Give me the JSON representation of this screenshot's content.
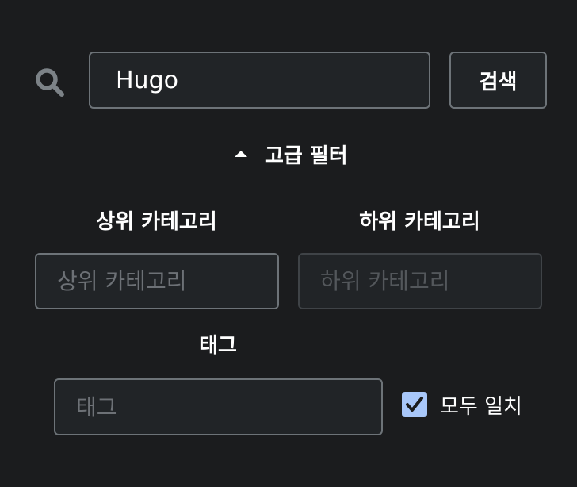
{
  "search": {
    "value": "Hugo",
    "button_label": "검색"
  },
  "advanced_filter": {
    "label": "고급 필터",
    "expanded": true
  },
  "fields": {
    "upper_category": {
      "label": "상위 카테고리",
      "placeholder": "상위 카테고리",
      "value": ""
    },
    "lower_category": {
      "label": "하위 카테고리",
      "placeholder": "하위 카테고리",
      "value": "",
      "disabled": true
    },
    "tag": {
      "label": "태그",
      "placeholder": "태그",
      "value": ""
    }
  },
  "match_all": {
    "label": "모두 일치",
    "checked": true
  },
  "colors": {
    "background": "#1b1c1e",
    "input_background": "#212427",
    "border": "#6d7378",
    "checkbox_accent": "#a8c7fa"
  },
  "icons": {
    "search": "search-icon",
    "filter_toggle": "caret-up-icon",
    "checkbox": "check-icon"
  }
}
